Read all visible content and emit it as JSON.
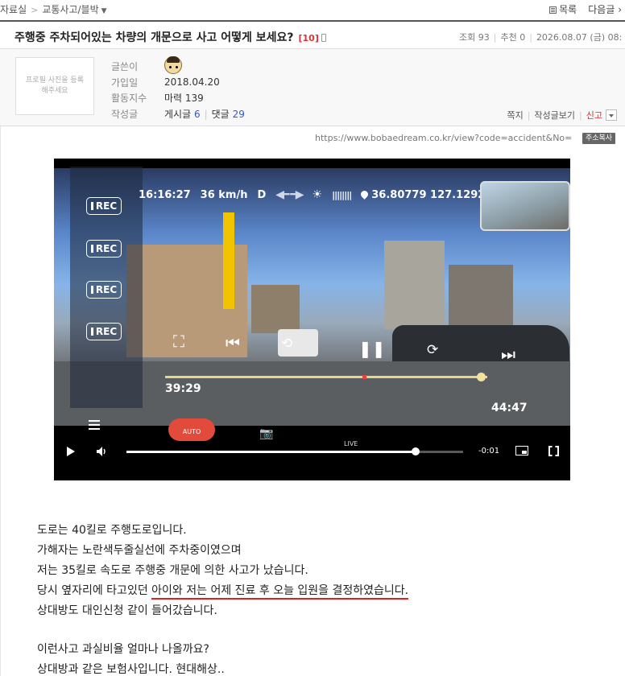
{
  "breadcrumb": {
    "root": "자료실",
    "current": "교통사고/블박"
  },
  "topnav": {
    "list": "목록",
    "next": "다음글"
  },
  "post": {
    "title": "주행중 주차되어있는 차량의 개문으로 사고 어떻게 보세요?",
    "comment_count": "[10]",
    "views_label": "조회",
    "views": "93",
    "recommend_label": "추천",
    "recommend": "0",
    "date": "2026.08.07 (금) 08:"
  },
  "author": {
    "avatar_placeholder": "프로필 사진을 등록해주세요",
    "rows": [
      {
        "label": "글쓴이",
        "value": ""
      },
      {
        "label": "가입일",
        "value": "2018.04.20"
      },
      {
        "label": "활동지수",
        "value": "마력 139"
      }
    ],
    "posts_row_label": "작성글",
    "posts_label": "게시글",
    "posts": "6",
    "comments_label": "댓글",
    "comments": "29",
    "buttons": {
      "message": "쪽지",
      "view_posts": "작성글보기",
      "report": "신고"
    }
  },
  "url": {
    "text": "https://www.bobaedream.co.kr/view?code=accident&No=",
    "copy": "주소복사"
  },
  "video": {
    "hud_time": "16:16:27",
    "hud_speed": "36 km/h",
    "hud_gear": "D",
    "hud_gps": "36.80779 127.12928",
    "rec_label": "REC",
    "elapsed": "39:29",
    "total": "44:47",
    "auto_label": "AUTO",
    "live_label": "LIVE",
    "player_time": "-0:01",
    "player_progress": 0.86,
    "dash_progress": 0.98
  },
  "content": {
    "lines": [
      "도로는 40킬로 주행도로입니다.",
      "가해자는 노란색두줄실선에 주차중이였으며",
      "저는 35킬로 속도로 주행중 개문에 의한 사고가 났습니다."
    ],
    "line4_prefix": "당시 옆자리에 타고있던 ",
    "line4_underlined": "아이와 저는 어제 진료 후 오늘 입원을 결정하였습니다.",
    "line5": "상대방도 대인신청 같이 들어갔습니다.",
    "line6": "이런사고 과실비율 얼마나 나올까요?",
    "line7": "상대방과 같은 보험사입니다. 현대해상.."
  }
}
